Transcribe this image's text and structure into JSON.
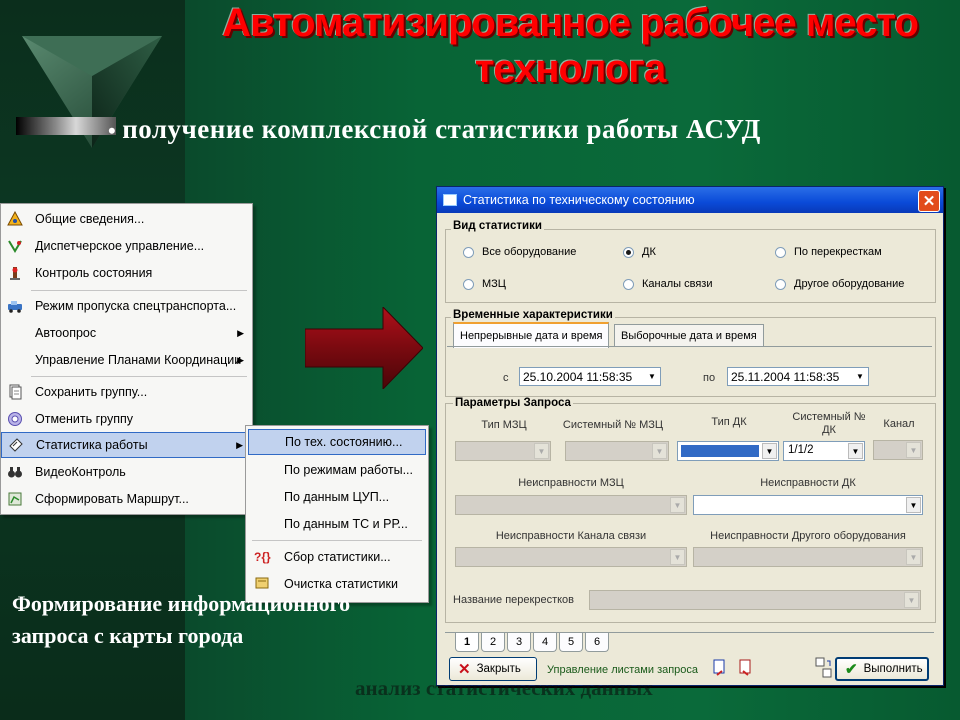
{
  "slide": {
    "title": "Автоматизированное рабочее место технолога",
    "bullet": "получение комплексной статистики работы АСУД",
    "caption": "Формирование информационного запроса с карты города",
    "footer_ghost": "анализ статистических данных"
  },
  "context_menu": {
    "items": [
      {
        "label": "Общие сведения...",
        "icon": "info-icon",
        "submenu": false
      },
      {
        "label": "Диспетчерское управление...",
        "icon": "control-icon",
        "submenu": false
      },
      {
        "label": "Контроль состояния",
        "icon": "status-icon",
        "submenu": false
      },
      {
        "label": "Режим пропуска спецтранспорта...",
        "icon": "vehicle-icon",
        "submenu": false
      },
      {
        "label": "Автоопрос",
        "icon": "",
        "submenu": true
      },
      {
        "label": "Управление Планами Координации",
        "icon": "",
        "submenu": true
      },
      {
        "label": "Сохранить группу...",
        "icon": "save-group-icon",
        "submenu": false
      },
      {
        "label": "Отменить группу",
        "icon": "cancel-group-icon",
        "submenu": false
      },
      {
        "label": "Статистика работы",
        "icon": "statistics-icon",
        "submenu": true,
        "selected": true
      },
      {
        "label": "ВидеоКонтроль",
        "icon": "binoculars-icon",
        "submenu": false
      },
      {
        "label": "Сформировать Маршрут...",
        "icon": "route-icon",
        "submenu": false
      }
    ]
  },
  "submenu": {
    "items": [
      {
        "label": "По тех. состоянию...",
        "selected": true
      },
      {
        "label": "По режимам работы..."
      },
      {
        "label": "По данным ЦУП..."
      },
      {
        "label": "По данным ТС и РР..."
      },
      {
        "label": "Сбор статистики...",
        "icon": "collect-icon"
      },
      {
        "label": "Очистка статистики",
        "icon": "clear-icon"
      }
    ]
  },
  "dialog": {
    "title": "Статистика по техническому состоянию",
    "stat_type": {
      "label": "Вид статистики",
      "options": [
        "Все оборудование",
        "ДК",
        "По перекресткам",
        "МЗЦ",
        "Каналы связи",
        "Другое оборудование"
      ],
      "selected": "ДК"
    },
    "time": {
      "label": "Временные характеристики",
      "tabs": [
        "Непрерывные дата и время",
        "Выборочные дата и время"
      ],
      "from_label": "с",
      "from_value": "25.10.2004  11:58:35",
      "to_label": "по",
      "to_value": "25.11.2004  11:58:35"
    },
    "params": {
      "label": "Параметры Запроса",
      "tip_mzc": "Тип МЗЦ",
      "sys_mzc": "Системный № МЗЦ",
      "tip_dk": "Тип ДК",
      "sys_dk": "Системный № ДК",
      "kanal": "Канал",
      "sys_dk_value": "1/1/2",
      "fault_mzc": "Неисправности МЗЦ",
      "fault_dk": "Неисправности ДК",
      "fault_channel": "Неисправности Канала связи",
      "fault_other": "Неисправности Другого оборудования",
      "crossroad_name": "Название перекрестков"
    },
    "pages": [
      "1",
      "2",
      "3",
      "4",
      "5",
      "6"
    ],
    "close_label": "Закрыть",
    "sheets_label": "Управление листами запроса",
    "execute_label": "Выполнить"
  }
}
